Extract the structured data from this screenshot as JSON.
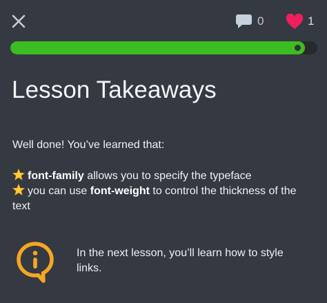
{
  "header": {
    "close_icon": "close-icon",
    "comments": {
      "icon": "comment-icon",
      "count": "0"
    },
    "lives": {
      "icon": "heart-icon",
      "count": "1",
      "color": "#ee1f5c"
    }
  },
  "progress": {
    "value_fraction": 0.96,
    "color": "#3cbd21"
  },
  "lesson": {
    "title": "Lesson Takeaways",
    "intro": "Well done! You’ve learned that:",
    "takeaways": [
      {
        "icon": "star-icon",
        "code": "font-family",
        "text": " allows you to specify the typeface"
      },
      {
        "icon": "star-icon",
        "prefix": "you can use ",
        "code": "font-weight",
        "text": " to control the thickness of the text"
      }
    ],
    "next": {
      "icon": "info-icon",
      "icon_color": "#f6a623",
      "text": "In the next lesson, you’ll learn how to style links."
    }
  }
}
